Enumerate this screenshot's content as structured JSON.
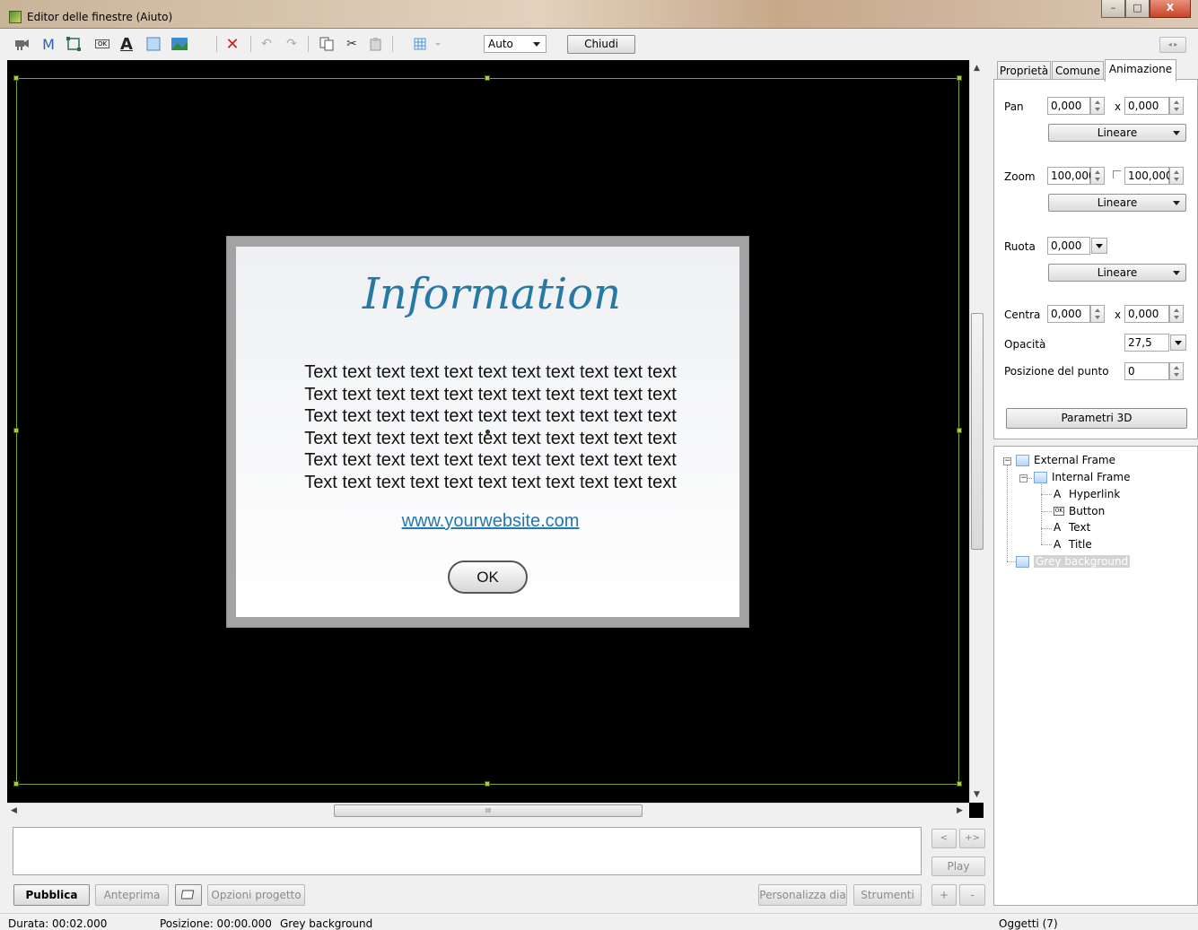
{
  "window": {
    "title": "Editor delle finestre (Aiuto)",
    "minimize": "–",
    "maximize": "□",
    "close": "X"
  },
  "toolbar": {
    "zoom_value": "Auto",
    "close_label": "Chiudi",
    "ok_icon_text": "OK",
    "m_icon_text": "M",
    "a_icon_text": "A",
    "nav_arrows": "◂ ▸"
  },
  "canvas": {
    "title": "Information",
    "body_lines": [
      "Text text text text text text text text text text text",
      "Text text text text text text text text text text text",
      "Text text text text text text text text text text text",
      "Text text text text text text text text text text text",
      "Text text text text text text text text text text text",
      "Text text text text text text text text text text text"
    ],
    "link": "www.yourwebsite.com",
    "ok_button": "OK",
    "hscroll_grip": "III"
  },
  "bottom": {
    "prev": "<",
    "next": "+>",
    "play": "Play",
    "pubblica": "Pubblica",
    "anteprima": "Anteprima",
    "opzioni": "Opzioni progetto",
    "personalizza": "Personalizza dia",
    "strumenti": "Strumenti",
    "plus": "+",
    "minus": "-"
  },
  "status": {
    "durata": "Durata: 00:02.000",
    "posizione": "Posizione: 00:00.000",
    "selected": "Grey background",
    "oggetti": "Oggetti (7)"
  },
  "panel": {
    "tabs": [
      "Proprietà",
      "Comune",
      "Animazione"
    ],
    "pan_label": "Pan",
    "pan_x": "0,000",
    "pan_y": "0,000",
    "x_sep": "x",
    "zoom_label": "Zoom",
    "zoom_x": "100,000",
    "zoom_y": "100,000",
    "ruota_label": "Ruota",
    "ruota_value": "0,000",
    "centra_label": "Centra",
    "centra_x": "0,000",
    "centra_y": "0,000",
    "opacita_label": "Opacità",
    "opacita_value": "27,5",
    "posizione_label": "Posizione del punto",
    "posizione_value": "0",
    "interp": "Lineare",
    "parametri_3d": "Parametri 3D"
  },
  "tree": {
    "external": "External Frame",
    "internal": "Internal Frame",
    "hyperlink": "Hyperlink",
    "button": "Button",
    "text": "Text",
    "title": "Title",
    "grey": "Grey background",
    "a_glyph": "A",
    "ok_badge": "OK"
  }
}
